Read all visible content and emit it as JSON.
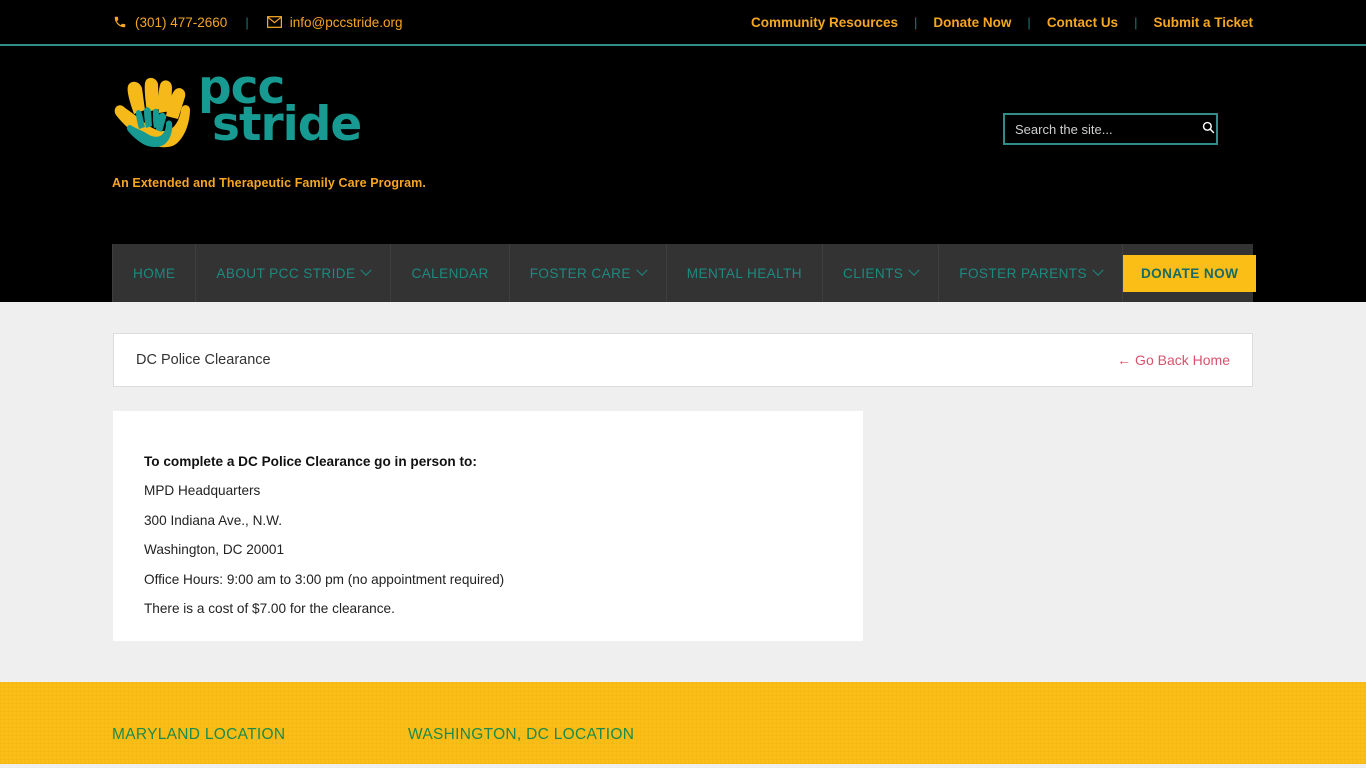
{
  "topbar": {
    "phone": "(301) 477-2660",
    "email": "info@pccstride.org",
    "separator": "|",
    "links": [
      {
        "label": "Community Resources"
      },
      {
        "label": "Donate Now"
      },
      {
        "label": "Contact Us"
      },
      {
        "label": "Submit a Ticket"
      }
    ]
  },
  "header": {
    "logo_line1": "pcc",
    "logo_line2": "stride",
    "tagline": "An Extended and Therapeutic Family Care Program.",
    "search_placeholder": "Search the site...",
    "search_value": ""
  },
  "nav": {
    "items": [
      {
        "label": "HOME",
        "caret": false
      },
      {
        "label": "ABOUT PCC STRIDE",
        "caret": true
      },
      {
        "label": "CALENDAR",
        "caret": false
      },
      {
        "label": "FOSTER CARE",
        "caret": true
      },
      {
        "label": "MENTAL HEALTH",
        "caret": false
      },
      {
        "label": "CLIENTS",
        "caret": true
      },
      {
        "label": "FOSTER PARENTS",
        "caret": true
      }
    ],
    "donate_label": "DONATE NOW"
  },
  "main": {
    "page_title": "DC Police Clearance",
    "go_back_label": "← Go Back Home",
    "body_lines": [
      {
        "text": "To complete a DC Police Clearance go in person to:",
        "bold": true
      },
      {
        "text": "MPD Headquarters",
        "bold": false
      },
      {
        "text": "300 Indiana Ave., N.W.",
        "bold": false
      },
      {
        "text": "Washington, DC 20001",
        "bold": false
      },
      {
        "text": "Office Hours: 9:00 am to 3:00 pm (no appointment required)",
        "bold": false
      },
      {
        "text": "There is a cost of $7.00 for the clearance.",
        "bold": false
      }
    ]
  },
  "footer": {
    "columns": [
      {
        "title": "MARYLAND LOCATION"
      },
      {
        "title": "WASHINGTON, DC LOCATION"
      }
    ]
  },
  "colors": {
    "accent_teal": "#179a91",
    "accent_amber": "#f5a623",
    "donate_yellow": "#fbbe16",
    "link_pink": "#d6536d",
    "nav_bg": "#333333",
    "footer_green": "#1b8a4a"
  }
}
